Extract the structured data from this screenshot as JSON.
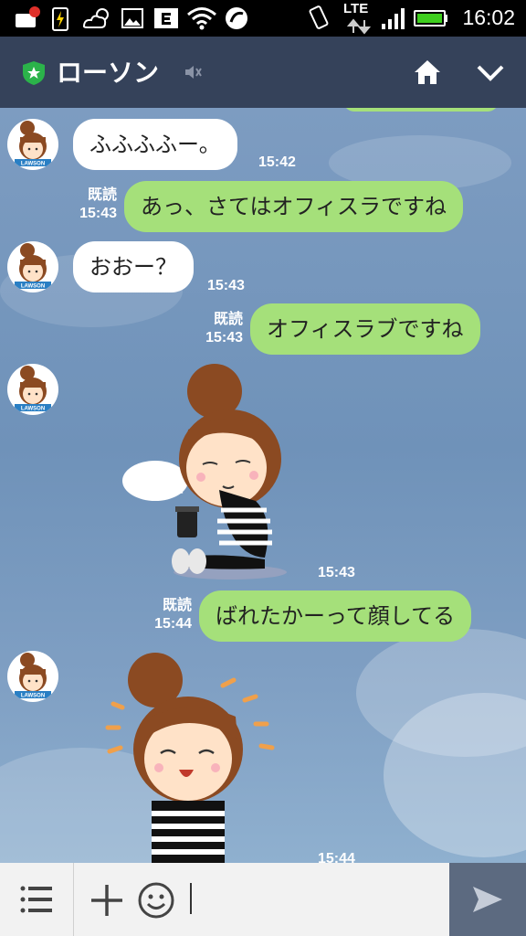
{
  "status_bar": {
    "time": "16:02",
    "network": "LTE"
  },
  "header": {
    "title": "ローソン"
  },
  "messages": [
    {
      "side": "left",
      "text": "ふふふふー。",
      "time": "15:42"
    },
    {
      "side": "right",
      "text": "あっ、さてはオフィスラですね",
      "read": "既読",
      "time": "15:43"
    },
    {
      "side": "left",
      "text": "おおー？",
      "time": "15:43"
    },
    {
      "side": "right",
      "text": "オフィスラブですね",
      "read": "既読",
      "time": "15:43"
    },
    {
      "side": "left",
      "sticker": "sticker-girl-sitting-coffee",
      "time": "15:43"
    },
    {
      "side": "right",
      "text": "ばれたかーって顔してる",
      "read": "既読",
      "time": "15:44"
    },
    {
      "side": "left",
      "sticker": "sticker-girl-smiling",
      "time": "15:44"
    }
  ],
  "avatar_badge": "LAWSON",
  "colors": {
    "header_bg": "#35425a",
    "my_bubble": "#a5e07a",
    "their_bubble": "#ffffff",
    "chat_bg": "#7393b9"
  }
}
